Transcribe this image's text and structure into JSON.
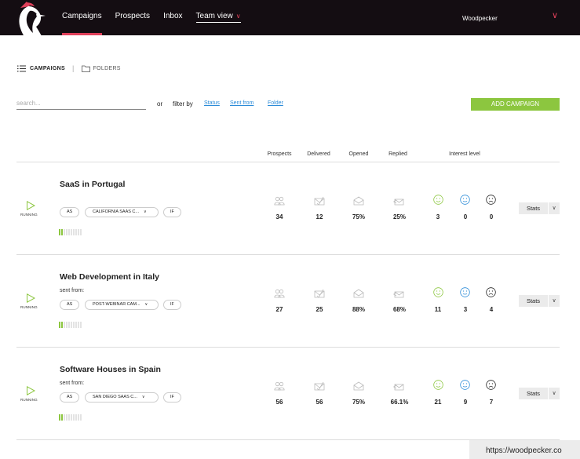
{
  "header": {
    "nav": [
      {
        "label": "Campaigns"
      },
      {
        "label": "Prospects"
      },
      {
        "label": "Inbox"
      },
      {
        "label": "Team view"
      }
    ],
    "account_name": "Woodpecker"
  },
  "breadcrumb": {
    "campaigns_label": "CAMPAIGNS",
    "folders_label": "FOLDERS"
  },
  "toolbar": {
    "search_placeholder": "search...",
    "or_label": "or",
    "filter_label": "filter by",
    "filters": [
      "Status",
      "Sent from",
      "Folder"
    ],
    "add_label": "ADD CAMPAIGN"
  },
  "columns": {
    "prospects": "Prospects",
    "delivered": "Delivered",
    "opened": "Opened",
    "replied": "Replied",
    "interest": "Interest level"
  },
  "colors": {
    "accent": "#e0405a",
    "green": "#8cc63f",
    "topbar": "#140d12",
    "link": "#2a8bd8",
    "happy": "#8cc63f",
    "neutral": "#2a8bd8",
    "sad": "#222222"
  },
  "campaigns": [
    {
      "title": "SaaS in Portugal",
      "sent_from": "",
      "status": "RUNNING",
      "chips": [
        "AS",
        "CALIFORNIA SAAS C...",
        "IF"
      ],
      "progress": 0.2,
      "prospects": "34",
      "delivered": "12",
      "opened": "75%",
      "replied": "25%",
      "interested": "3",
      "maybe": "0",
      "not_interested": "0",
      "stats_label": "Stats"
    },
    {
      "title": "Web Development in Italy",
      "sent_from": "sent from:",
      "status": "RUNNING",
      "chips": [
        "AS",
        "POST-WEBINAR CAM...",
        "IF"
      ],
      "progress": 0.2,
      "prospects": "27",
      "delivered": "25",
      "opened": "88%",
      "replied": "68%",
      "interested": "11",
      "maybe": "3",
      "not_interested": "4",
      "stats_label": "Stats"
    },
    {
      "title": "Software Houses in Spain",
      "sent_from": "sent from:",
      "status": "RUNNING",
      "chips": [
        "AS",
        "SAN DIEGO SAAS C...",
        "IF"
      ],
      "progress": 0.2,
      "prospects": "56",
      "delivered": "56",
      "opened": "75%",
      "replied": "66.1%",
      "interested": "21",
      "maybe": "9",
      "not_interested": "7",
      "stats_label": "Stats"
    }
  ],
  "footer": {
    "url": "https://woodpecker.co"
  }
}
